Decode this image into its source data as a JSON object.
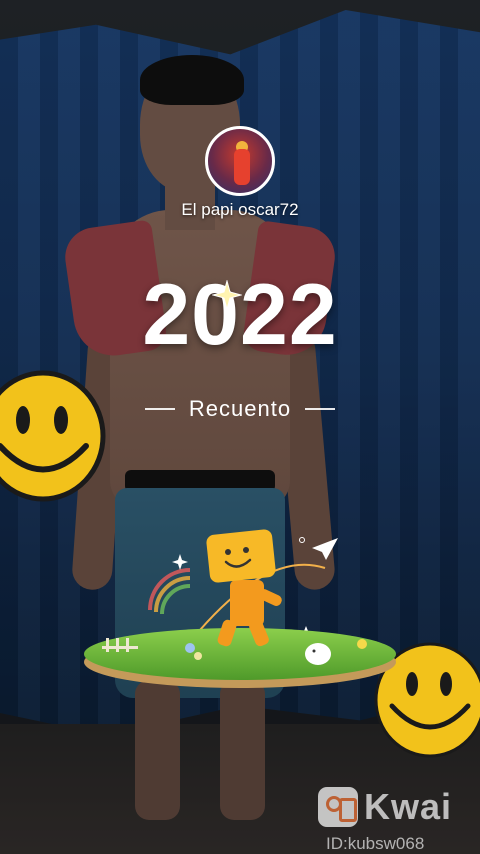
{
  "profile": {
    "avatar_icon": "avatar-image",
    "username": "El papi oscar72"
  },
  "hero": {
    "year": "2022",
    "subtitle": "Recuento"
  },
  "decorations": {
    "left_smiley": "smiley-icon",
    "right_smiley": "smiley-icon",
    "island": "island-illustration",
    "sparkle": "sparkle-icon"
  },
  "watermark": {
    "brand": "Kwai",
    "user_id": "ID:kubsw068"
  },
  "colors": {
    "smiley_yellow": "#f2c21b",
    "smiley_outline": "#1a1a1a",
    "grass": "#6fb43a",
    "character": "#f39a1e",
    "curtain_blue": "#1d4a87"
  }
}
